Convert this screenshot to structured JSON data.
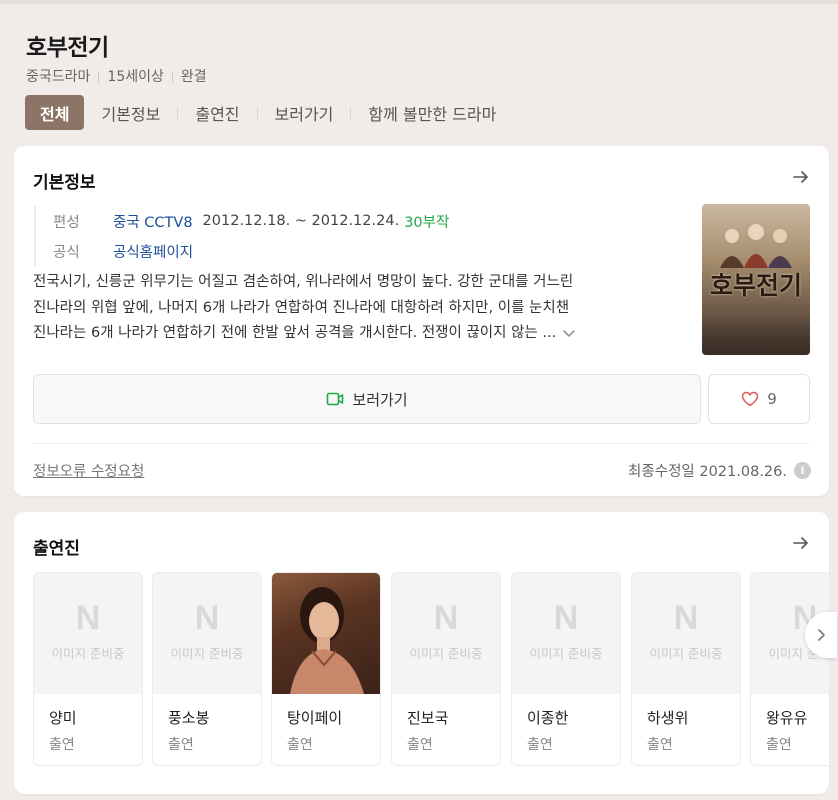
{
  "drama": {
    "title": "호부전기",
    "genre": "중국드라마",
    "rating": "15세이상",
    "status": "완결"
  },
  "tabs": [
    {
      "label": "전체",
      "active": true
    },
    {
      "label": "기본정보",
      "active": false
    },
    {
      "label": "출연진",
      "active": false
    },
    {
      "label": "보러가기",
      "active": false
    },
    {
      "label": "함께 볼만한 드라마",
      "active": false
    }
  ],
  "basic_info": {
    "section_title": "기본정보",
    "broadcast_label": "편성",
    "broadcast_value": "중국 CCTV8",
    "period": "2012.12.18. ~ 2012.12.24.",
    "episodes": "30부작",
    "official_label": "공식",
    "official_value": "공식홈페이지",
    "description_lines": [
      "전국시기, 신릉군 위무기는 어질고 겸손하여, 위나라에서 명망이 높다. 강한 군대를 거느린",
      "진나라의 위협 앞에, 나머지 6개 나라가 연합하여 진나라에 대항하려 하지만, 이를 눈치챈",
      "진나라는 6개 나라가 연합하기 전에 한발 앞서 공격을 개시한다. 전쟁이 끊이지 않는 ..."
    ],
    "poster_title": "호부전기",
    "watch_label": "보러가기",
    "like_count": "9",
    "report_label": "정보오류 수정요청",
    "updated": "최종수정일 2021.08.26."
  },
  "cast_section": {
    "section_title": "출연진",
    "placeholder_logo": "N",
    "placeholder_text": "이미지 준비중",
    "members": [
      {
        "name": "양미",
        "role": "출연",
        "has_photo": false
      },
      {
        "name": "풍소봉",
        "role": "출연",
        "has_photo": false
      },
      {
        "name": "탕이페이",
        "role": "출연",
        "has_photo": true
      },
      {
        "name": "진보국",
        "role": "출연",
        "has_photo": false
      },
      {
        "name": "이종한",
        "role": "출연",
        "has_photo": false
      },
      {
        "name": "하생위",
        "role": "출연",
        "has_photo": false
      },
      {
        "name": "왕유유",
        "role": "출연",
        "has_photo": false
      }
    ]
  },
  "colors": {
    "accent_tab": "#8c7566",
    "link_blue": "#1f4e9a",
    "episode_green": "#21a84a",
    "heart": "#e05a5a",
    "background": "#f1ece9"
  }
}
